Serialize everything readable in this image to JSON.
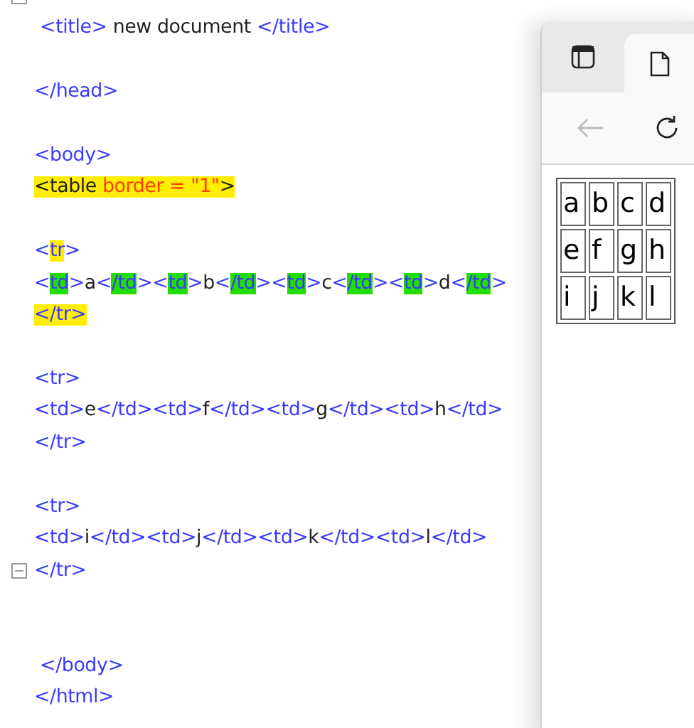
{
  "editor": {
    "lines": [
      {
        "fold": true
      },
      {
        "fold": false,
        "segments": [
          {
            "text": " <title>",
            "kind": "tag"
          },
          {
            "text": " new document ",
            "kind": "text"
          },
          {
            "text": "</title>",
            "kind": "tag"
          }
        ]
      },
      {
        "fold": false
      },
      {
        "fold": false,
        "segments": [
          {
            "text": "</head>",
            "kind": "tag"
          }
        ]
      },
      {
        "fold": false
      },
      {
        "fold": false,
        "segments": [
          {
            "text": "<body>",
            "kind": "tag"
          }
        ]
      },
      {
        "fold": false,
        "segments": [
          {
            "text": "<table",
            "kind": "text",
            "color": "#ffee00"
          },
          {
            "text": " border = \"1\"",
            "kind": "attr",
            "color": "#ffee00"
          },
          {
            "text": ">",
            "kind": "text",
            "color": "#ffee00"
          }
        ]
      },
      {
        "fold": false
      },
      {
        "fold": false,
        "segments": [
          {
            "text": "<",
            "kind": "tag"
          },
          {
            "text": "tr",
            "kind": "tag",
            "color": "#ffee00"
          },
          {
            "text": ">",
            "kind": "tag"
          }
        ]
      },
      {
        "fold": false,
        "segments": [
          {
            "text": "<",
            "kind": "tag"
          },
          {
            "text": "td",
            "kind": "tag",
            "color": "#22dd00"
          },
          {
            "text": ">",
            "kind": "tag"
          },
          {
            "text": "a",
            "kind": "text"
          },
          {
            "text": "<",
            "kind": "tag"
          },
          {
            "text": "/td",
            "kind": "tag",
            "color": "#22dd00"
          },
          {
            "text": ">",
            "kind": "tag"
          },
          {
            "text": "<",
            "kind": "tag"
          },
          {
            "text": "td",
            "kind": "tag",
            "color": "#22dd00"
          },
          {
            "text": ">",
            "kind": "tag"
          },
          {
            "text": "b",
            "kind": "text"
          },
          {
            "text": "<",
            "kind": "tag"
          },
          {
            "text": "/td",
            "kind": "tag",
            "color": "#22dd00"
          },
          {
            "text": ">",
            "kind": "tag"
          },
          {
            "text": "<",
            "kind": "tag"
          },
          {
            "text": "td",
            "kind": "tag",
            "color": "#22dd00"
          },
          {
            "text": ">",
            "kind": "tag"
          },
          {
            "text": "c",
            "kind": "text"
          },
          {
            "text": "<",
            "kind": "tag"
          },
          {
            "text": "/td",
            "kind": "tag",
            "color": "#22dd00"
          },
          {
            "text": ">",
            "kind": "tag"
          },
          {
            "text": "<",
            "kind": "tag"
          },
          {
            "text": "td",
            "kind": "tag",
            "color": "#22dd00"
          },
          {
            "text": ">",
            "kind": "tag"
          },
          {
            "text": "d",
            "kind": "text"
          },
          {
            "text": "<",
            "kind": "tag"
          },
          {
            "text": "/td",
            "kind": "tag",
            "color": "#22dd00"
          },
          {
            "text": ">",
            "kind": "tag"
          }
        ]
      },
      {
        "fold": false,
        "segments": [
          {
            "text": "</tr>",
            "kind": "tag",
            "color": "#ffee00"
          }
        ]
      },
      {
        "fold": false
      },
      {
        "fold": false,
        "segments": [
          {
            "text": "<tr>",
            "kind": "tag"
          }
        ]
      },
      {
        "fold": false,
        "segments": [
          {
            "text": "<td>",
            "kind": "tag"
          },
          {
            "text": "e",
            "kind": "text"
          },
          {
            "text": "</td><td>",
            "kind": "tag"
          },
          {
            "text": "f",
            "kind": "text"
          },
          {
            "text": "</td><td>",
            "kind": "tag"
          },
          {
            "text": "g",
            "kind": "text"
          },
          {
            "text": "</td><td>",
            "kind": "tag"
          },
          {
            "text": "h",
            "kind": "text"
          },
          {
            "text": "</td>",
            "kind": "tag"
          }
        ]
      },
      {
        "fold": false,
        "segments": [
          {
            "text": "</tr>",
            "kind": "tag"
          }
        ]
      },
      {
        "fold": false
      },
      {
        "fold": false,
        "segments": [
          {
            "text": "<tr>",
            "kind": "tag"
          }
        ]
      },
      {
        "fold": false,
        "segments": [
          {
            "text": "<td>",
            "kind": "tag"
          },
          {
            "text": "i",
            "kind": "text"
          },
          {
            "text": "</td><td>",
            "kind": "tag"
          },
          {
            "text": "j",
            "kind": "text"
          },
          {
            "text": "</td><td>",
            "kind": "tag"
          },
          {
            "text": "k",
            "kind": "text"
          },
          {
            "text": "</td><td>",
            "kind": "tag"
          },
          {
            "text": "l",
            "kind": "text"
          },
          {
            "text": "</td>",
            "kind": "tag"
          }
        ]
      },
      {
        "fold": true,
        "segments": [
          {
            "text": "</tr>",
            "kind": "tag"
          }
        ]
      },
      {
        "fold": false
      },
      {
        "fold": false
      },
      {
        "fold": false,
        "segments": [
          {
            "text": " </body>",
            "kind": "tag"
          }
        ]
      },
      {
        "fold": false,
        "segments": [
          {
            "text": "</html>",
            "kind": "tag"
          }
        ]
      }
    ]
  },
  "browser": {
    "tabs": [
      {
        "kind": "tab-actions",
        "selected": false
      },
      {
        "kind": "page",
        "selected": true
      }
    ],
    "back_disabled": true,
    "table": [
      [
        "a",
        "b",
        "c",
        "d"
      ],
      [
        "e",
        "f",
        "g",
        "h"
      ],
      [
        "i",
        "j",
        "k",
        "l"
      ]
    ]
  }
}
